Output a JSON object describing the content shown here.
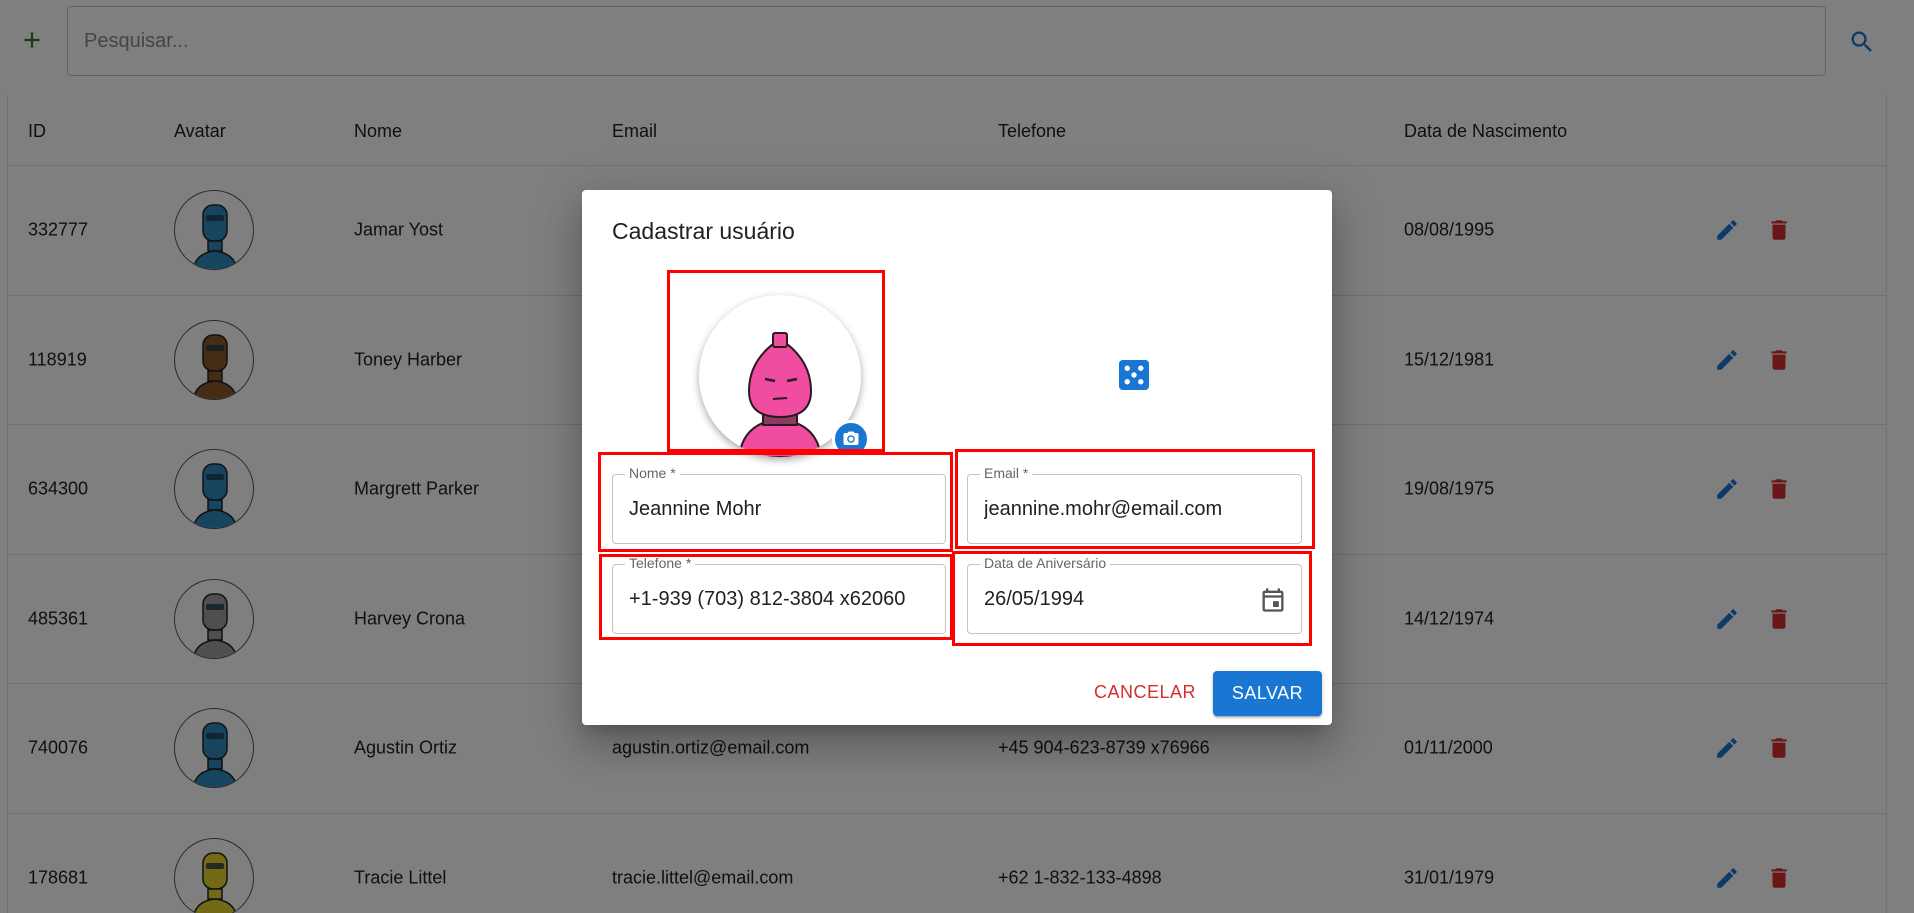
{
  "toolbar": {
    "add_icon": "plus-icon",
    "search_placeholder": "Pesquisar...",
    "search_icon": "search-icon",
    "colors": {
      "add": "#2e7d32",
      "search": "#1976d2"
    }
  },
  "table": {
    "columns": [
      "ID",
      "Avatar",
      "Nome",
      "Email",
      "Telefone",
      "Data de Nascimento"
    ],
    "rows": [
      {
        "id": "332777",
        "name": "Jamar Yost",
        "email": "",
        "phone": "",
        "birth": "08/08/1995",
        "avatar_color": "#2e8bc0"
      },
      {
        "id": "118919",
        "name": "Toney Harber",
        "email": "",
        "phone": "",
        "birth": "15/12/1981",
        "avatar_color": "#8b5a2b"
      },
      {
        "id": "634300",
        "name": "Margrett Parker",
        "email": "",
        "phone": "",
        "birth": "19/08/1975",
        "avatar_color": "#2e8bc0"
      },
      {
        "id": "485361",
        "name": "Harvey Crona",
        "email": "",
        "phone": "",
        "birth": "14/12/1974",
        "avatar_color": "#9e9e9e"
      },
      {
        "id": "740076",
        "name": "Agustin Ortiz",
        "email": "agustin.ortiz@email.com",
        "phone": "+45 904-623-8739 x76966",
        "birth": "01/11/2000",
        "avatar_color": "#2e8bc0"
      },
      {
        "id": "178681",
        "name": "Tracie Littel",
        "email": "tracie.littel@email.com",
        "phone": "+62 1-832-133-4898",
        "birth": "31/01/1979",
        "avatar_color": "#e6d22e"
      }
    ],
    "edit_icon": "pencil-icon",
    "delete_icon": "trash-icon"
  },
  "dialog": {
    "title": "Cadastrar usuário",
    "avatar_color": "#f04ca0",
    "camera_icon": "camera-icon",
    "dice_icon": "dice-icon",
    "fields": {
      "nome": {
        "label": "Nome *",
        "value": "Jeannine Mohr"
      },
      "email": {
        "label": "Email *",
        "value": "jeannine.mohr@email.com"
      },
      "telefone": {
        "label": "Telefone *",
        "value": "+1-939 (703) 812-3804 x62060"
      },
      "aniversario": {
        "label": "Data de Aniversário",
        "value": "26/05/1994"
      }
    },
    "calendar_icon": "calendar-icon",
    "cancel_label": "CANCELAR",
    "save_label": "SALVAR",
    "colors": {
      "primary": "#1976d2",
      "cancel": "#d32f2f"
    }
  }
}
